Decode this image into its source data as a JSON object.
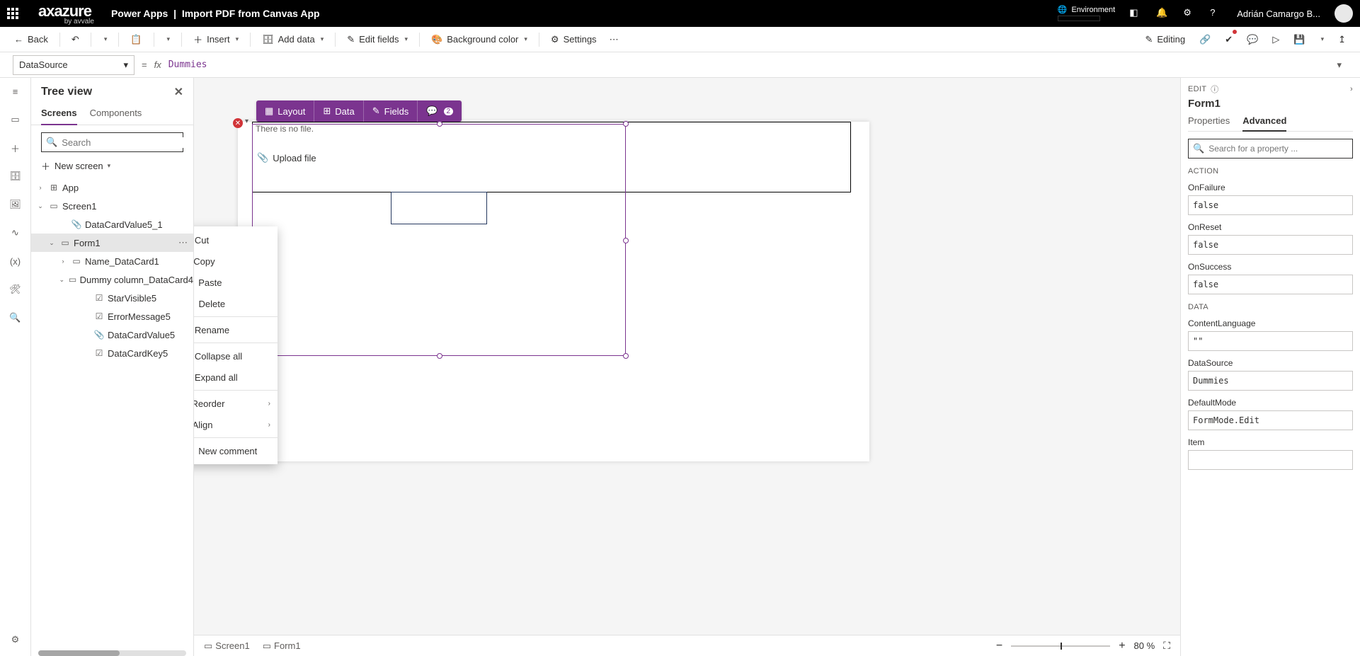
{
  "header": {
    "logo_main": "axazure",
    "logo_sub": "by avvale",
    "app_label": "Power Apps",
    "page_title": "Import PDF from Canvas App",
    "env_label": "Environment",
    "user_name": "Adrián Camargo B..."
  },
  "toolbar": {
    "back": "Back",
    "insert": "Insert",
    "add_data": "Add data",
    "edit_fields": "Edit fields",
    "bg_color": "Background color",
    "settings": "Settings",
    "editing": "Editing"
  },
  "formula": {
    "prop": "DataSource",
    "fx": "fx",
    "value": "Dummies"
  },
  "tree": {
    "title": "Tree view",
    "tab_screens": "Screens",
    "tab_components": "Components",
    "search_placeholder": "Search",
    "new_screen": "New screen",
    "items": {
      "app": "App",
      "screen1": "Screen1",
      "dcv51": "DataCardValue5_1",
      "form1": "Form1",
      "name_dc": "Name_DataCard1",
      "dummy_dc": "Dummy column_DataCard4",
      "star": "StarVisible5",
      "err": "ErrorMessage5",
      "dcv5": "DataCardValue5",
      "dck5": "DataCardKey5"
    }
  },
  "canvas": {
    "nofile": "There is no file.",
    "upload": "Upload file"
  },
  "minitb": {
    "layout": "Layout",
    "data": "Data",
    "fields": "Fields",
    "badge": "2"
  },
  "ctx": {
    "cut": "Cut",
    "copy": "Copy",
    "paste": "Paste",
    "delete": "Delete",
    "rename": "Rename",
    "collapse": "Collapse all",
    "expand": "Expand all",
    "reorder": "Reorder",
    "align": "Align",
    "comment": "New comment"
  },
  "status": {
    "screen": "Screen1",
    "form": "Form1",
    "zoom": "80  %"
  },
  "rp": {
    "edit": "EDIT",
    "name": "Form1",
    "tab_props": "Properties",
    "tab_adv": "Advanced",
    "search_placeholder": "Search for a property ...",
    "sec_action": "ACTION",
    "sec_data": "DATA",
    "fields": {
      "onfailure_l": "OnFailure",
      "onfailure_v": "false",
      "onreset_l": "OnReset",
      "onreset_v": "false",
      "onsuccess_l": "OnSuccess",
      "onsuccess_v": "false",
      "contentlang_l": "ContentLanguage",
      "contentlang_v": "\"\"",
      "datasource_l": "DataSource",
      "datasource_v": "Dummies",
      "defaultmode_l": "DefaultMode",
      "defaultmode_v": "FormMode.Edit",
      "item_l": "Item",
      "item_v": ""
    }
  }
}
